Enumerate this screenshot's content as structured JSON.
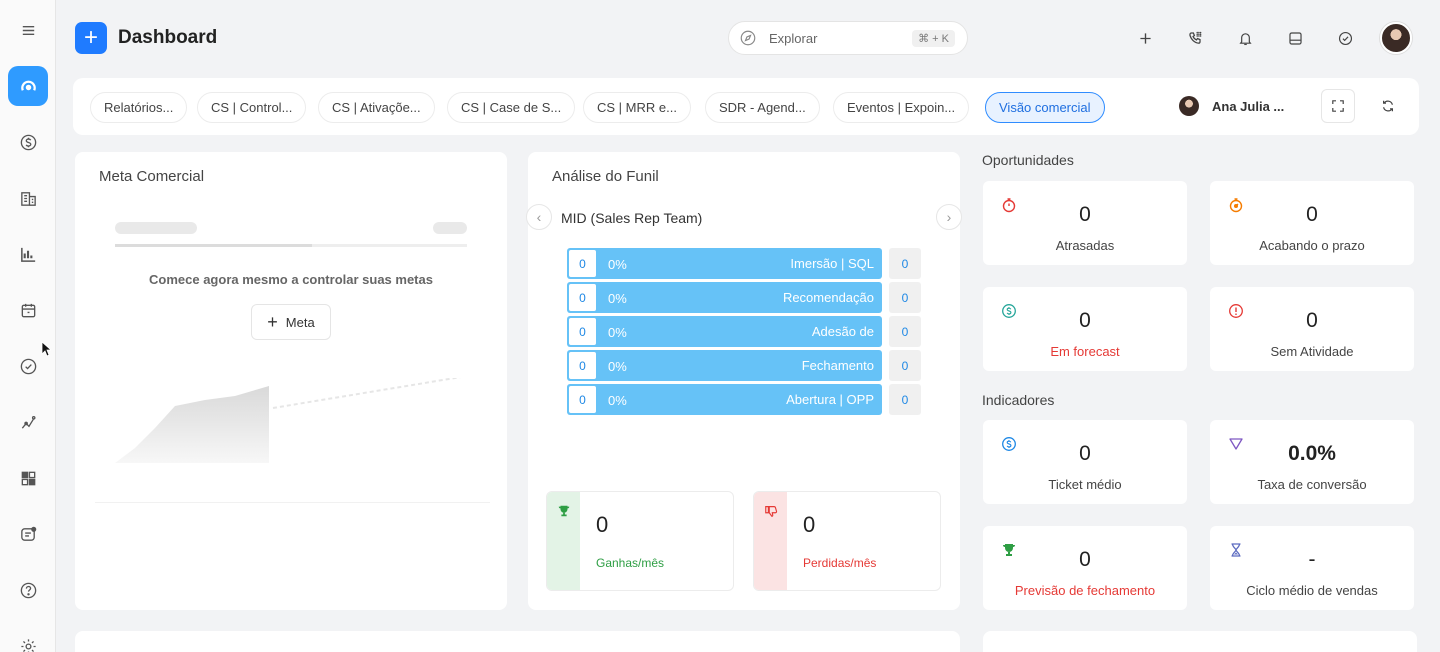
{
  "app": {
    "title": "Dashboard"
  },
  "search": {
    "placeholder": "Explorar",
    "shortcut": "⌘ + K"
  },
  "tabs": [
    {
      "label": "Relatórios..."
    },
    {
      "label": "CS | Control..."
    },
    {
      "label": "CS | Ativaçõe..."
    },
    {
      "label": "CS | Case de S..."
    },
    {
      "label": "CS | MRR e..."
    },
    {
      "label": "SDR - Agend..."
    },
    {
      "label": "Eventos | Expoin..."
    },
    {
      "label": "Visão comercial",
      "active": true
    }
  ],
  "user": {
    "name": "Ana Julia ..."
  },
  "meta_comercial": {
    "title": "Meta Comercial",
    "empty_text": "Comece agora mesmo a controlar suas metas",
    "button_label": "Meta"
  },
  "funil": {
    "title": "Análise do Funil",
    "team": "MID (Sales Rep Team)",
    "stages": [
      {
        "count": "0",
        "percent": "0%",
        "name": "Imersão | SQL",
        "side": "0"
      },
      {
        "count": "0",
        "percent": "0%",
        "name": "Recomendação",
        "side": "0"
      },
      {
        "count": "0",
        "percent": "0%",
        "name": "Adesão de",
        "side": "0"
      },
      {
        "count": "0",
        "percent": "0%",
        "name": "Fechamento",
        "side": "0"
      },
      {
        "count": "0",
        "percent": "0%",
        "name": "Abertura | OPP",
        "side": "0"
      }
    ],
    "won": {
      "value": "0",
      "label": "Ganhas/mês",
      "color": "#2e9e44"
    },
    "lost": {
      "value": "0",
      "label": "Perdidas/mês",
      "color": "#e53935"
    }
  },
  "oportunidades": {
    "title": "Oportunidades",
    "cards": [
      {
        "value": "0",
        "label": "Atrasadas",
        "icon": "stopwatch-icon"
      },
      {
        "value": "0",
        "label": "Acabando o prazo",
        "icon": "stopwatch-alert-icon"
      },
      {
        "value": "0",
        "label": "Em forecast",
        "icon": "dollar-circle-icon"
      },
      {
        "value": "0",
        "label": "Sem Atividade",
        "icon": "alert-circle-icon"
      }
    ]
  },
  "indicadores": {
    "title": "Indicadores",
    "cards": [
      {
        "value": "0",
        "label": "Ticket médio",
        "icon": "dollar-circle-icon"
      },
      {
        "value": "0.0%",
        "label": "Taxa de conversão",
        "icon": "funnel-icon"
      },
      {
        "value": "0",
        "label": "Previsão de fechamento",
        "icon": "trophy-icon"
      },
      {
        "value": "-",
        "label": "Ciclo médio de vendas",
        "icon": "hourglass-icon"
      }
    ]
  },
  "colors": {
    "accent": "#1f7bff",
    "funnel_bar": "#66c2f7",
    "danger": "#e53935",
    "success": "#2e9e44"
  }
}
